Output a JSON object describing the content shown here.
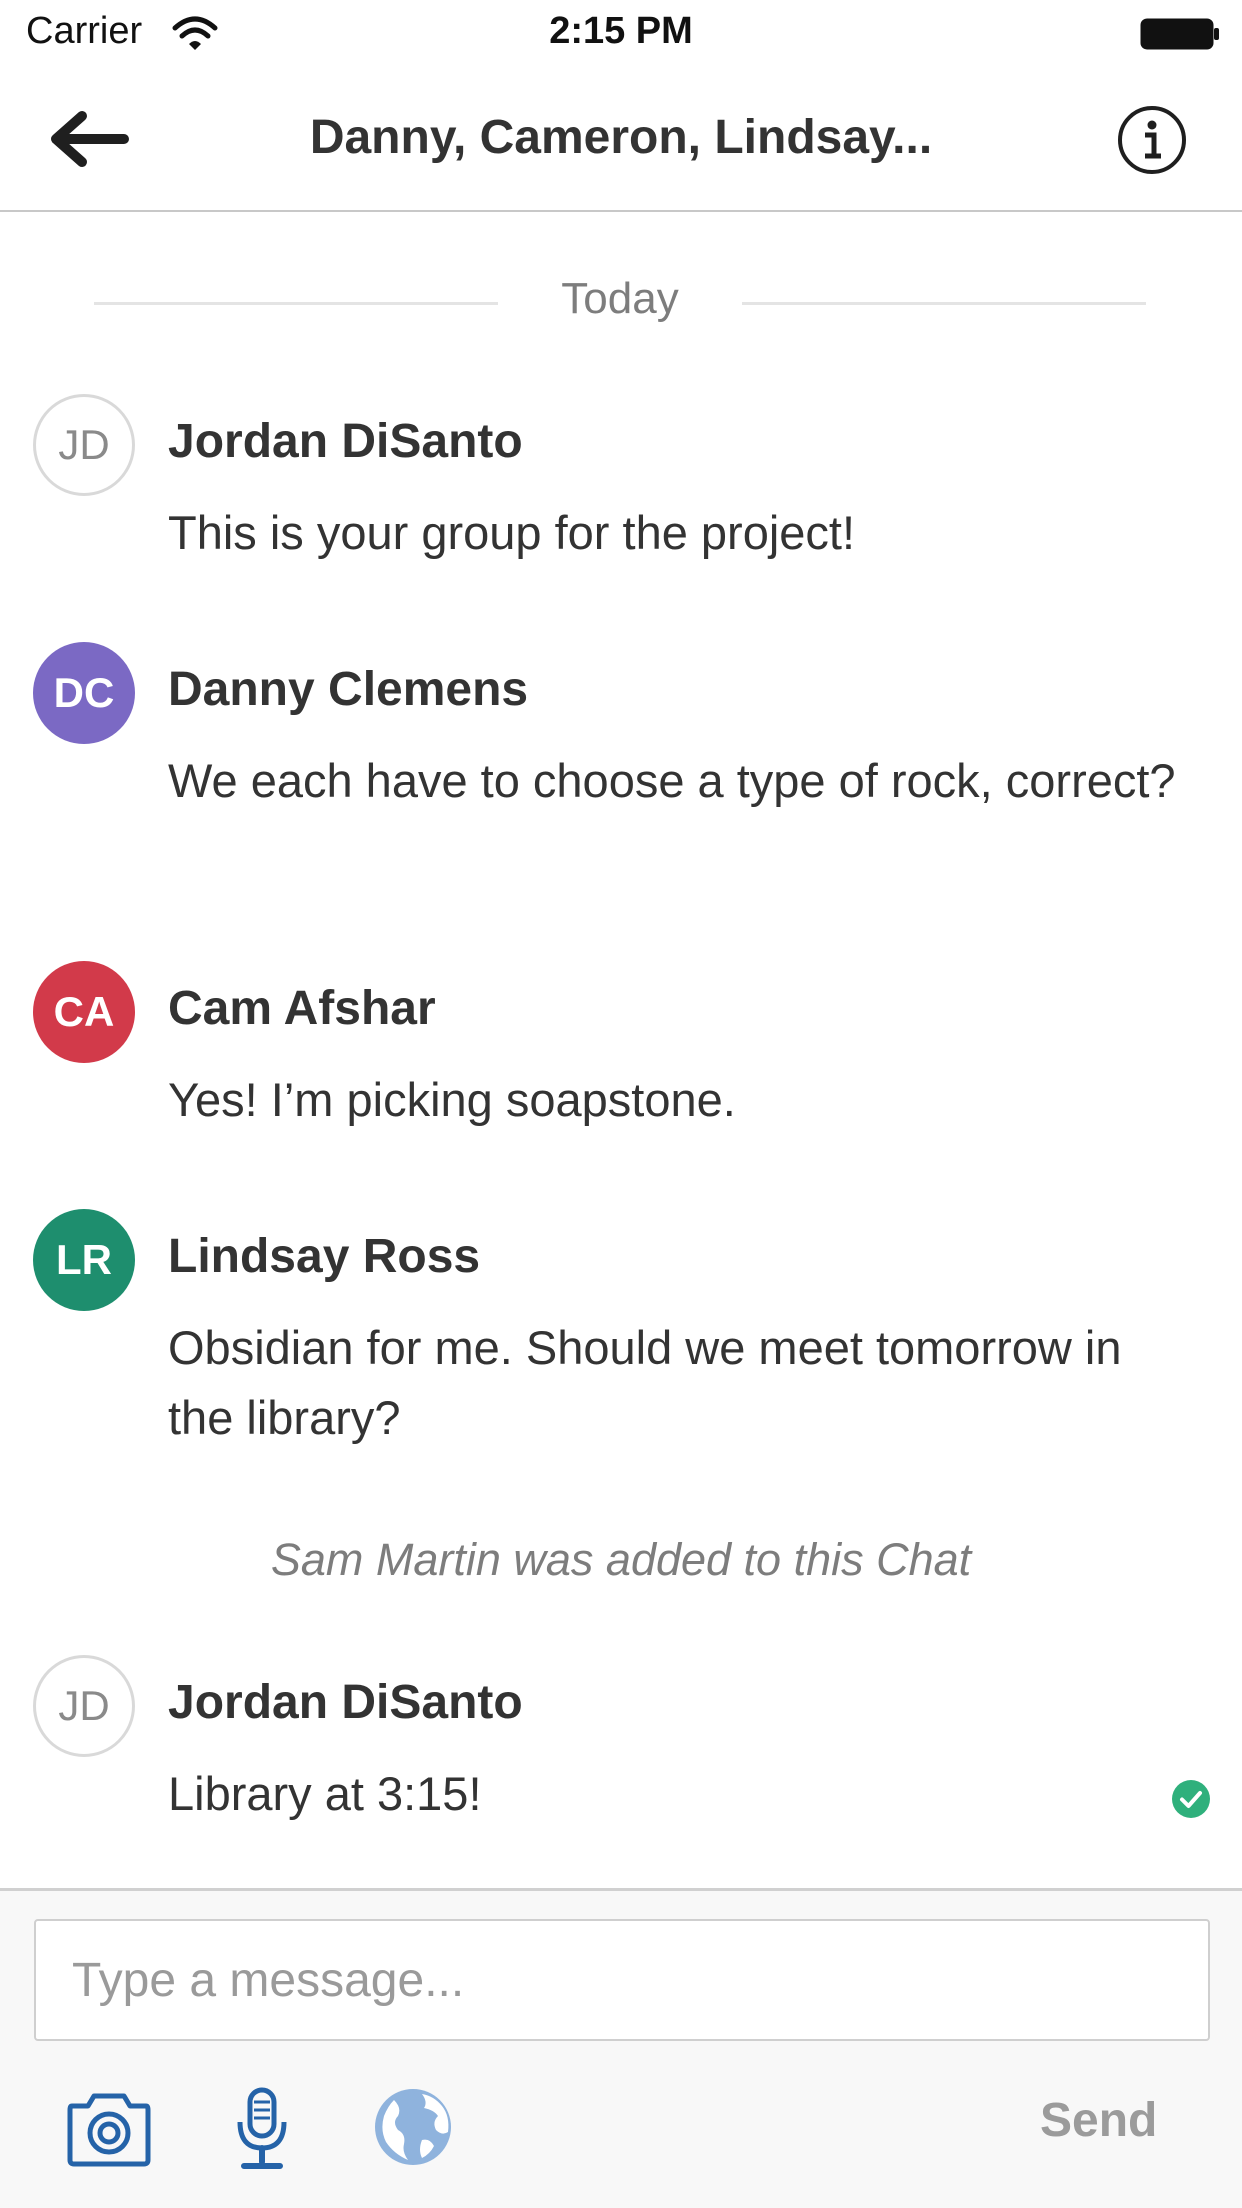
{
  "status_bar": {
    "carrier": "Carrier",
    "time": "2:15 PM"
  },
  "header": {
    "title": "Danny, Cameron, Lindsay...",
    "back_icon": "arrow-left-icon",
    "info_icon": "info-icon"
  },
  "conversation": {
    "day_label": "Today",
    "messages": [
      {
        "initials": "JD",
        "sender": "Jordan DiSanto",
        "text": "This is your group for the project!"
      },
      {
        "initials": "DC",
        "sender": "Danny Clemens",
        "text": "We each have to choose a type of rock, correct?",
        "avatar_color": "#7b69c4"
      },
      {
        "initials": "CA",
        "sender": "Cam Afshar",
        "text": "Yes! I’m picking soapstone.",
        "avatar_color": "#d23a4a"
      },
      {
        "initials": "LR",
        "sender": "Lindsay Ross",
        "text": "Obsidian for me. Should we meet tomorrow in the library?",
        "avatar_color": "#1e8e6e"
      },
      {
        "initials": "JD",
        "sender": "Jordan DiSanto",
        "text": "Library at 3:15!",
        "status_icon": "check-circle-icon"
      }
    ],
    "system_note": "Sam Martin was added to this Chat"
  },
  "composer": {
    "placeholder": "Type a message...",
    "send_label": "Send",
    "tools": [
      "camera-icon",
      "microphone-icon",
      "globe-icon"
    ],
    "accent_color": "#2563a8"
  },
  "colors": {
    "delivered": "#2fb07c",
    "muted_text": "#7d7d7d"
  }
}
